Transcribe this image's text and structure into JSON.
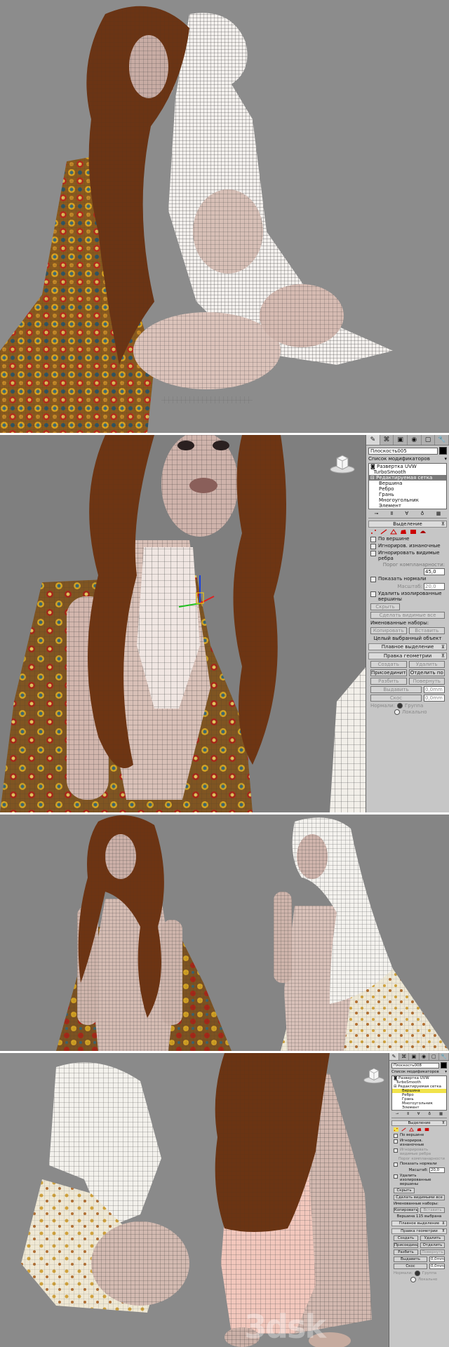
{
  "panel_2": {
    "tabs": [
      "✎",
      "⌘",
      "▣",
      "◉",
      "▢",
      "🔧"
    ],
    "object_name": "Плоскость005",
    "modifier_list_label": "Список модификаторов",
    "stack": [
      {
        "label": "Развертка UVW",
        "type": "mod"
      },
      {
        "label": "TurboSmooth",
        "type": "mod"
      },
      {
        "label": "Редактируемая сетка",
        "type": "base"
      },
      {
        "label": "Вершина",
        "type": "sub"
      },
      {
        "label": "Ребро",
        "type": "sub"
      },
      {
        "label": "Грань",
        "type": "sub"
      },
      {
        "label": "Многоугольник",
        "type": "sub"
      },
      {
        "label": "Элемент",
        "type": "sub"
      }
    ],
    "selection": {
      "title": "Выделение",
      "by_vertex": "По вершине",
      "ignore_backfacing": "Игнориров. изнаночные",
      "ignore_visible_edges": "Игнорировать видимые ребра",
      "planar_threshold_label": "Порог компланарности:",
      "planar_threshold_value": "45,0",
      "show_normals": "Показать нормали",
      "scale_label": "Масштаб:",
      "scale_value": "20,0",
      "delete_isolated": "Удалить изолированные вершины",
      "hide": "Скрыть",
      "make_visible": "Сделать видимые все",
      "named_sets": "Именованные наборы:",
      "copy": "Копировать",
      "paste": "Вставить",
      "status": "Целый выбранный объект"
    },
    "soft_selection": "Плавное выделение",
    "edit_geometry": {
      "title": "Правка геометрии",
      "create": "Создать",
      "delete": "Удалить",
      "attach": "Присоединить",
      "detach": "Отделить по",
      "break": "Разбить",
      "turn": "Повернуть",
      "extrude": "Выдавить",
      "extrude_value": "0,0mm",
      "bevel": "Скос",
      "bevel_value": "0,0mm",
      "normal_label": "Нормали:",
      "group": "Группа",
      "local": "Локально"
    }
  },
  "panel_4": {
    "tabs": [
      "✎",
      "⌘",
      "▣",
      "◉",
      "▢",
      "🔧"
    ],
    "object_name": "Плоскость008",
    "modifier_list_label": "Список модификаторов",
    "stack": [
      {
        "label": "Развертка UVW",
        "type": "mod"
      },
      {
        "label": "TurboSmooth",
        "type": "mod"
      },
      {
        "label": "Редактируемая сетка",
        "type": "base"
      },
      {
        "label": "Вершина",
        "type": "sub-hi"
      },
      {
        "label": "Ребро",
        "type": "sub"
      },
      {
        "label": "Грань",
        "type": "sub"
      },
      {
        "label": "Многоугольник",
        "type": "sub"
      },
      {
        "label": "Элемент",
        "type": "sub"
      }
    ],
    "selection": {
      "title": "Выделение",
      "by_vertex": "По вершине",
      "ignore_backfacing": "Игнориров. изнаночные",
      "ignore_visible_edges": "Игнорировать видимые ребра",
      "planar_threshold_label": "Порог компланарности",
      "show_normals": "Показать нормали",
      "scale_label": "Масштаб:",
      "scale_value": "20,0",
      "delete_isolated": "Удалить изолированные вершины",
      "hide": "Скрыть",
      "make_visible": "Сделать видимыми все",
      "named_sets": "Именованные наборы:",
      "copy": "Копировать",
      "paste": "Вставить",
      "status": "Вершина 115 выбрана"
    },
    "soft_selection": "Плавное выделение",
    "edit_geometry": {
      "title": "Правка геометрии",
      "create": "Создать",
      "delete": "Удалить",
      "attach": "Присоединить",
      "detach": "Отделить",
      "break": "Разбить",
      "turn": "Повернуть",
      "extrude": "Выдавить",
      "extrude_value": "0,0mm",
      "bevel": "Скос",
      "bevel_value": "0,0mm",
      "normal_label": "Нормали:",
      "group": "Группа",
      "local": "Локально"
    }
  },
  "watermark": "3dsk"
}
